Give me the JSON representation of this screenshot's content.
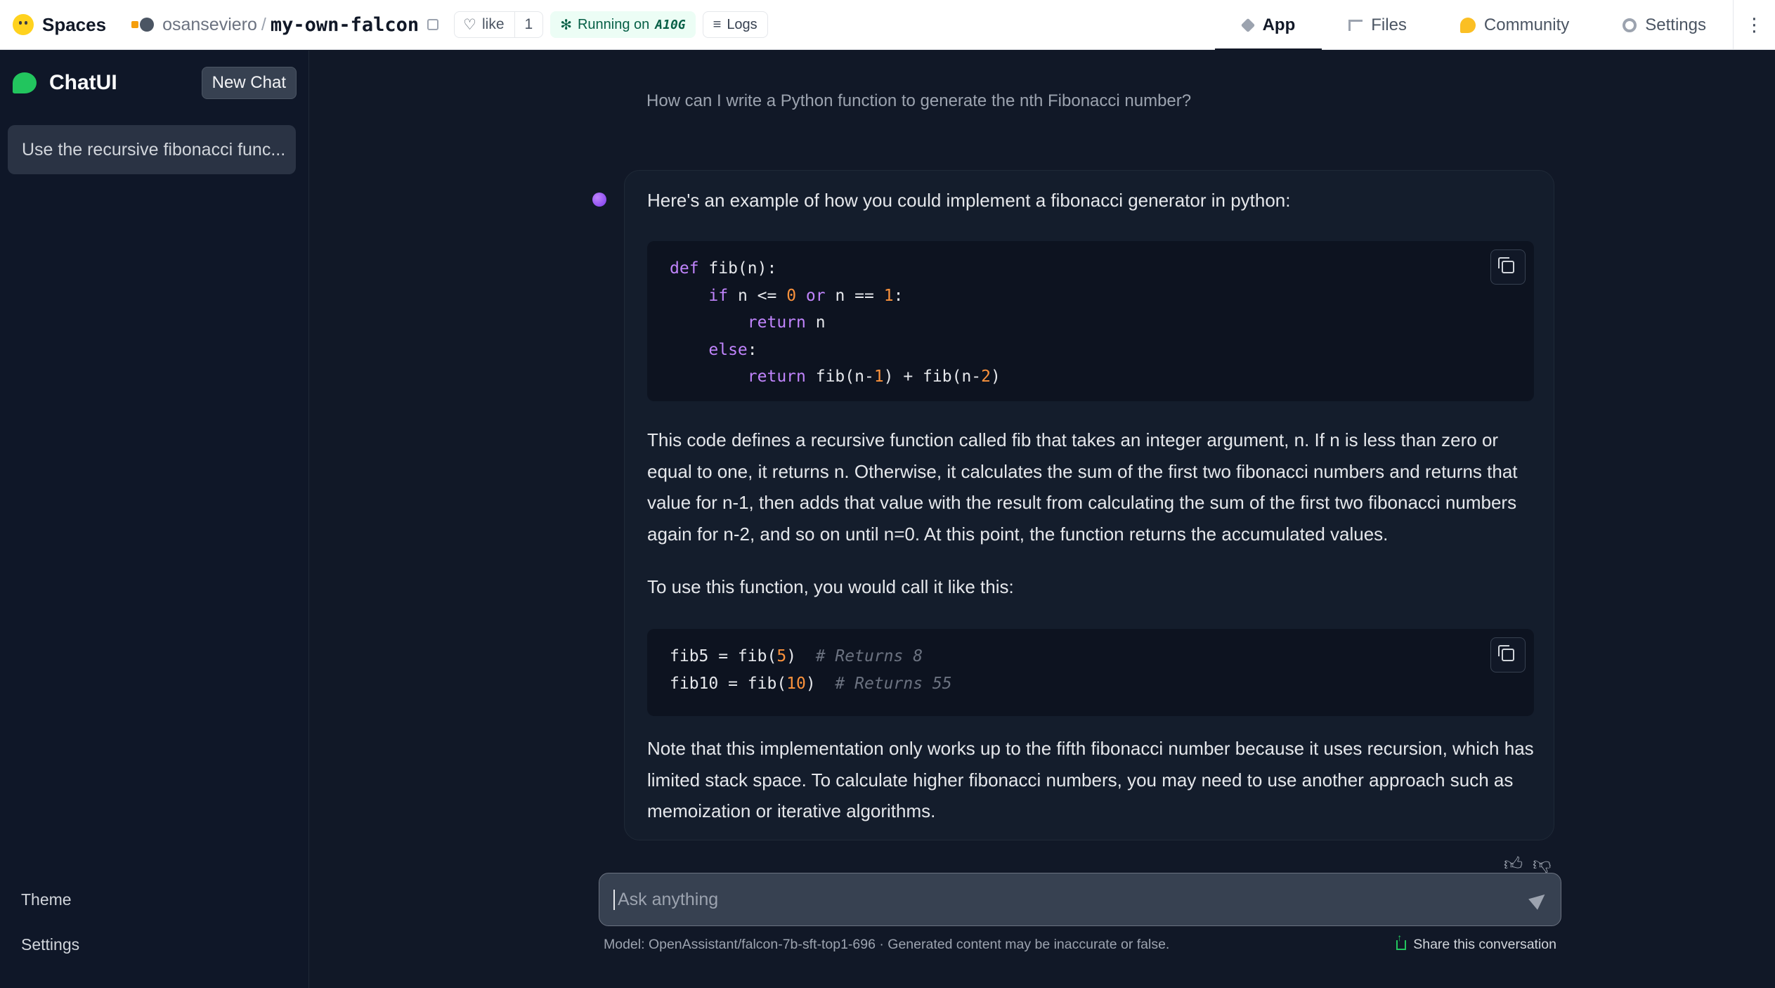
{
  "topbar": {
    "brand": "Spaces",
    "repo_owner": "osanseviero",
    "repo_sep": "/",
    "repo_name": "my-own-falcon",
    "like_label": "like",
    "like_count": "1",
    "running_label": "Running on",
    "running_hw": "A10G",
    "logs_label": "Logs",
    "tabs": [
      {
        "label": "App",
        "icon": "box-icon"
      },
      {
        "label": "Files",
        "icon": "files-icon"
      },
      {
        "label": "Community",
        "icon": "community-icon"
      },
      {
        "label": "Settings",
        "icon": "gear-icon"
      }
    ],
    "more_glyph": "⋮"
  },
  "sidebar": {
    "app_name": "ChatUI",
    "new_chat": "New Chat",
    "conversations": [
      "Use the recursive fibonacci func..."
    ],
    "theme": "Theme",
    "settings": "Settings"
  },
  "chat": {
    "user_message": "How can I write a Python function to generate the nth Fibonacci number?",
    "para1": "Here's an example of how you could implement a fibonacci generator in python:",
    "para2": "This code defines a recursive function called fib that takes an integer argument, n. If n is less than zero or equal to one, it returns n. Otherwise, it calculates the sum of the first two fibonacci numbers and returns that value for n-1, then adds that value with the result from calculating the sum of the first two fibonacci numbers again for n-2, and so on until n=0. At this point, the function returns the accumulated values.",
    "para3": "To use this function, you would call it like this:",
    "para4": "Note that this implementation only works up to the fifth fibonacci number because it uses recursion, which has limited stack space. To calculate higher fibonacci numbers, you may need to use another approach such as memoization or iterative algorithms.",
    "code1": {
      "l1_kw": "def",
      "l1": " fib(n):",
      "l2_kw": "if",
      "l2a": " n <= ",
      "l2n": "0",
      "l2_or": "or",
      "l2b": " n == ",
      "l2n2": "1",
      "l2c": ":",
      "l3_kw": "return",
      "l3": " n",
      "l4_kw": "else",
      "l4": ":",
      "l5_kw": "return",
      "l5a": " fib(n-",
      "l5n": "1",
      "l5b": ") + fib(n-",
      "l5n2": "2",
      "l5c": ")"
    },
    "code2": {
      "l1a": "fib5 = fib(",
      "l1n": "5",
      "l1b": ")  ",
      "l1c": "# Returns 8",
      "l2a": "fib10 = fib(",
      "l2n": "10",
      "l2b": ")  ",
      "l2c": "# Returns 55"
    }
  },
  "input": {
    "placeholder": "Ask anything"
  },
  "footer": {
    "model_note": "Model: OpenAssistant/falcon-7b-sft-top1-696 · Generated content may be inaccurate or false.",
    "share": "Share this conversation"
  }
}
